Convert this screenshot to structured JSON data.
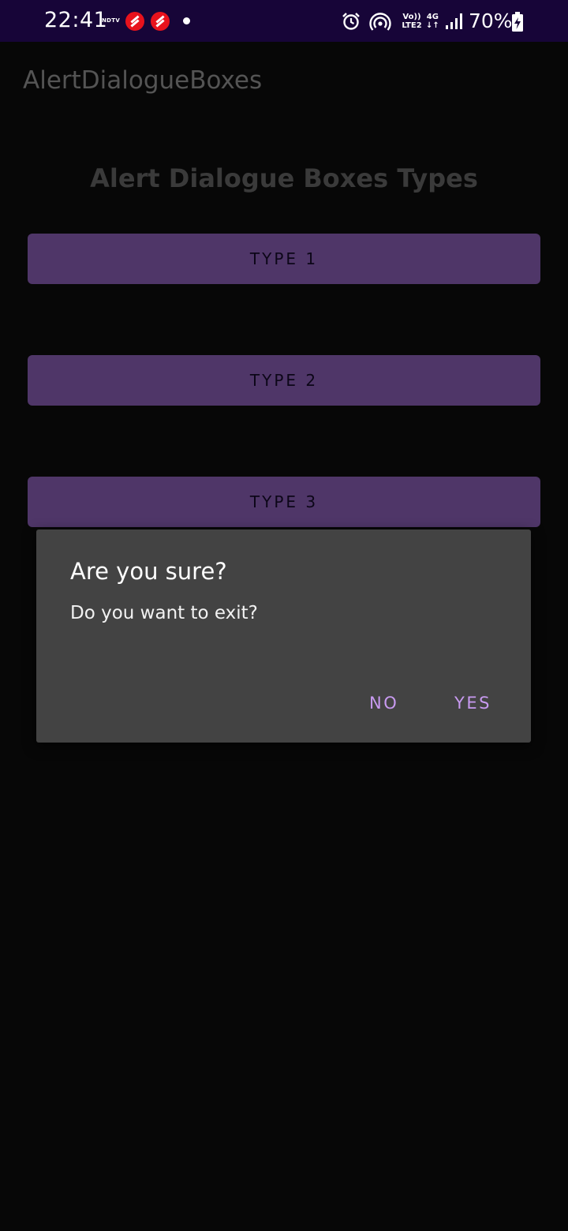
{
  "status_bar": {
    "time": "22:41",
    "ndtv_label": "NDTV",
    "network_label_top": "Vo))",
    "network_label_bottom": "LTE2",
    "data_label_top": "4G",
    "data_label_bottom": "↓↑",
    "battery_percent": "70%",
    "icons": [
      "alarm-icon",
      "hotspot-icon",
      "signal-icon",
      "battery-charging-icon"
    ]
  },
  "app_bar": {
    "title": "AlertDialogueBoxes"
  },
  "main": {
    "heading": "Alert Dialogue Boxes Types",
    "buttons": [
      {
        "label": "TYPE 1"
      },
      {
        "label": "TYPE 2"
      },
      {
        "label": "TYPE 3"
      }
    ]
  },
  "dialog": {
    "title": "Are you sure?",
    "message": "Do you want to exit?",
    "negative_label": "NO",
    "positive_label": "YES"
  },
  "colors": {
    "status_bar_bg": "#170538",
    "button_bg": "#4f3668",
    "dialog_bg": "#434343",
    "dialog_action": "#c89af0"
  }
}
